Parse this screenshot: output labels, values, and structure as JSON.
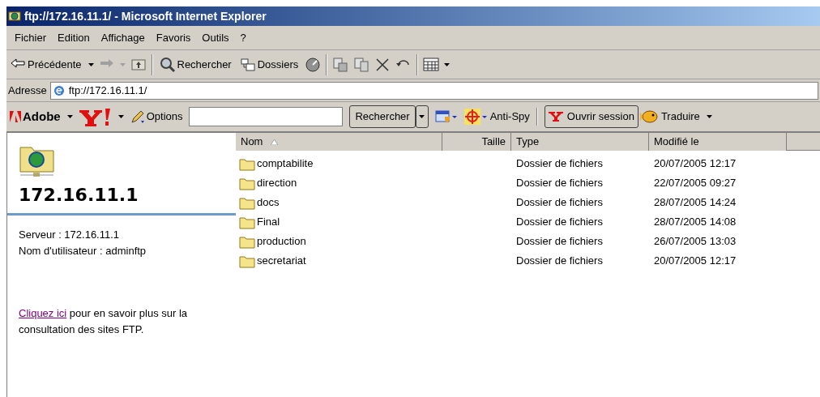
{
  "window": {
    "title": "ftp://172.16.11.1/ - Microsoft Internet Explorer"
  },
  "menu": [
    "Fichier",
    "Edition",
    "Affichage",
    "Favoris",
    "Outils",
    "?"
  ],
  "toolbar": [
    {
      "kind": "back",
      "label": "Précédente"
    },
    {
      "kind": "forward"
    },
    {
      "kind": "up"
    },
    {
      "kind": "sep"
    },
    {
      "kind": "search",
      "label": "Rechercher"
    },
    {
      "kind": "folders",
      "label": "Dossiers"
    },
    {
      "kind": "history"
    },
    {
      "kind": "sep"
    },
    {
      "kind": "moveto"
    },
    {
      "kind": "copyto"
    },
    {
      "kind": "delete"
    },
    {
      "kind": "undo"
    },
    {
      "kind": "sep"
    },
    {
      "kind": "views"
    }
  ],
  "address": {
    "label": "Adresse",
    "value": "ftp://172.16.11.1/"
  },
  "links_bar": {
    "adobe": "Adobe",
    "options": "Options",
    "search_button": "Rechercher",
    "antispy": "Anti-Spy",
    "login": "Ouvrir session",
    "translate": "Traduire"
  },
  "sidebar": {
    "title": "172.16.11.1",
    "server": "Serveur : 172.16.11.1",
    "user": "Nom d'utilisateur : adminftp",
    "link": "Cliquez ici",
    "info": "pour en savoir plus sur la consultation des sites FTP."
  },
  "table": {
    "columns": [
      {
        "label": "Nom",
        "sorted": true
      },
      {
        "label": "Taille",
        "sorted": false
      },
      {
        "label": "Type",
        "sorted": false
      },
      {
        "label": "Modifié le",
        "sorted": false
      }
    ],
    "rows": [
      {
        "name": "comptabilite",
        "type": "Dossier de fichiers",
        "modified": "20/07/2005 12:17"
      },
      {
        "name": "direction",
        "type": "Dossier de fichiers",
        "modified": "22/07/2005 09:27"
      },
      {
        "name": "docs",
        "type": "Dossier de fichiers",
        "modified": "28/07/2005 14:24"
      },
      {
        "name": "Final",
        "type": "Dossier de fichiers",
        "modified": "28/07/2005 14:08"
      },
      {
        "name": "production",
        "type": "Dossier de fichiers",
        "modified": "26/07/2005 13:03"
      },
      {
        "name": "secretariat",
        "type": "Dossier de fichiers",
        "modified": "20/07/2005 12:17"
      }
    ]
  }
}
